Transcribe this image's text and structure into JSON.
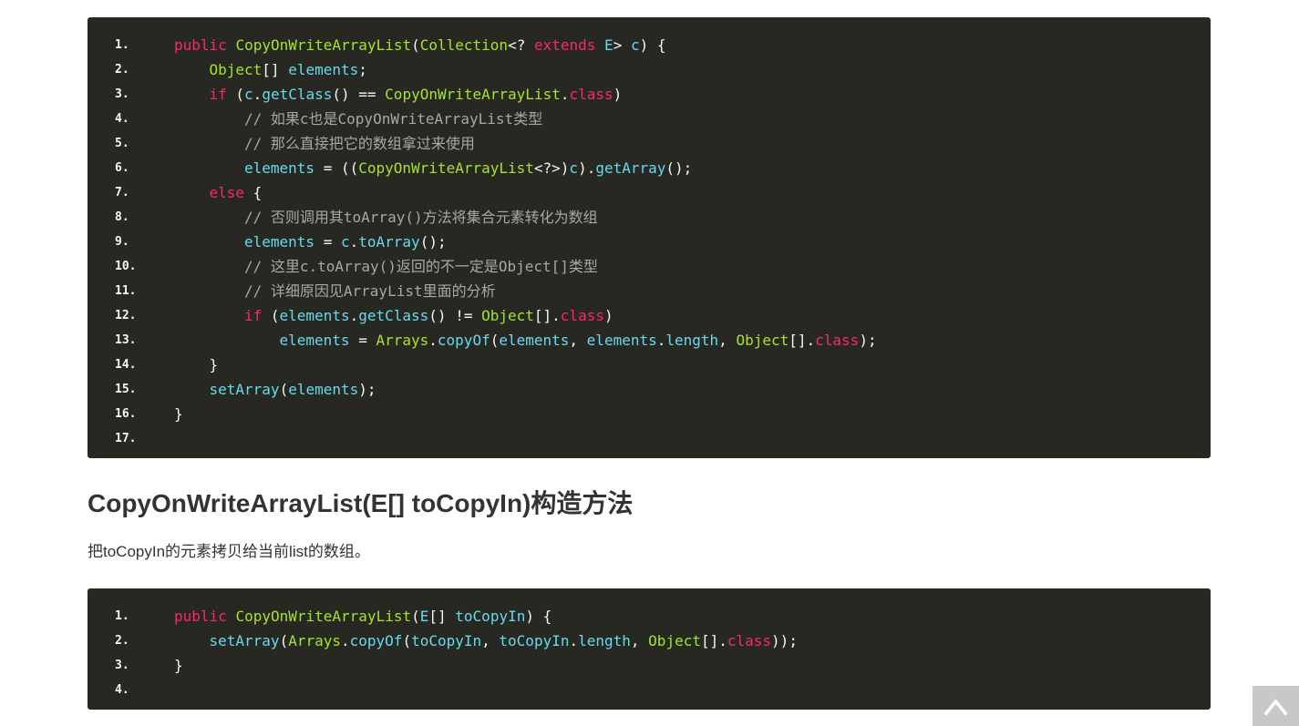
{
  "code_block_1": {
    "lines": [
      {
        "n": "1.",
        "indent": 0,
        "tokens": [
          [
            "k",
            "public"
          ],
          [
            "p",
            " "
          ],
          [
            "t",
            "CopyOnWriteArrayList"
          ],
          [
            "p",
            "("
          ],
          [
            "t",
            "Collection"
          ],
          [
            "p",
            "<? "
          ],
          [
            "k",
            "extends"
          ],
          [
            "p",
            " "
          ],
          [
            "v",
            "E"
          ],
          [
            "p",
            "> "
          ],
          [
            "v",
            "c"
          ],
          [
            "p",
            ") {"
          ]
        ]
      },
      {
        "n": "2.",
        "indent": 1,
        "tokens": [
          [
            "t",
            "Object"
          ],
          [
            "p",
            "[] "
          ],
          [
            "v",
            "elements"
          ],
          [
            "p",
            ";"
          ]
        ]
      },
      {
        "n": "3.",
        "indent": 1,
        "tokens": [
          [
            "k",
            "if"
          ],
          [
            "p",
            " ("
          ],
          [
            "v",
            "c"
          ],
          [
            "p",
            "."
          ],
          [
            "v",
            "getClass"
          ],
          [
            "p",
            "() == "
          ],
          [
            "t",
            "CopyOnWriteArrayList"
          ],
          [
            "p",
            "."
          ],
          [
            "k",
            "class"
          ],
          [
            "p",
            ")"
          ]
        ]
      },
      {
        "n": "4.",
        "indent": 2,
        "tokens": [
          [
            "c",
            "// 如果c也是CopyOnWriteArrayList类型"
          ]
        ]
      },
      {
        "n": "5.",
        "indent": 2,
        "tokens": [
          [
            "c",
            "// 那么直接把它的数组拿过来使用"
          ]
        ]
      },
      {
        "n": "6.",
        "indent": 2,
        "tokens": [
          [
            "v",
            "elements"
          ],
          [
            "p",
            " = (("
          ],
          [
            "t",
            "CopyOnWriteArrayList"
          ],
          [
            "p",
            "<?>)"
          ],
          [
            "v",
            "c"
          ],
          [
            "p",
            ")."
          ],
          [
            "v",
            "getArray"
          ],
          [
            "p",
            "();"
          ]
        ]
      },
      {
        "n": "7.",
        "indent": 1,
        "tokens": [
          [
            "k",
            "else"
          ],
          [
            "p",
            " {"
          ]
        ]
      },
      {
        "n": "8.",
        "indent": 2,
        "tokens": [
          [
            "c",
            "// 否则调用其toArray()方法将集合元素转化为数组"
          ]
        ]
      },
      {
        "n": "9.",
        "indent": 2,
        "tokens": [
          [
            "v",
            "elements"
          ],
          [
            "p",
            " = "
          ],
          [
            "v",
            "c"
          ],
          [
            "p",
            "."
          ],
          [
            "v",
            "toArray"
          ],
          [
            "p",
            "();"
          ]
        ]
      },
      {
        "n": "10.",
        "indent": 2,
        "tokens": [
          [
            "c",
            "// 这里c.toArray()返回的不一定是Object[]类型"
          ]
        ]
      },
      {
        "n": "11.",
        "indent": 2,
        "tokens": [
          [
            "c",
            "// 详细原因见ArrayList里面的分析"
          ]
        ]
      },
      {
        "n": "12.",
        "indent": 2,
        "tokens": [
          [
            "k",
            "if"
          ],
          [
            "p",
            " ("
          ],
          [
            "v",
            "elements"
          ],
          [
            "p",
            "."
          ],
          [
            "v",
            "getClass"
          ],
          [
            "p",
            "() != "
          ],
          [
            "t",
            "Object"
          ],
          [
            "p",
            "[]."
          ],
          [
            "k",
            "class"
          ],
          [
            "p",
            ")"
          ]
        ]
      },
      {
        "n": "13.",
        "indent": 3,
        "tokens": [
          [
            "v",
            "elements"
          ],
          [
            "p",
            " = "
          ],
          [
            "t",
            "Arrays"
          ],
          [
            "p",
            "."
          ],
          [
            "v",
            "copyOf"
          ],
          [
            "p",
            "("
          ],
          [
            "v",
            "elements"
          ],
          [
            "p",
            ", "
          ],
          [
            "v",
            "elements"
          ],
          [
            "p",
            "."
          ],
          [
            "v",
            "length"
          ],
          [
            "p",
            ", "
          ],
          [
            "t",
            "Object"
          ],
          [
            "p",
            "[]."
          ],
          [
            "k",
            "class"
          ],
          [
            "p",
            ");"
          ]
        ]
      },
      {
        "n": "14.",
        "indent": 1,
        "tokens": [
          [
            "p",
            "}"
          ]
        ]
      },
      {
        "n": "15.",
        "indent": 1,
        "tokens": [
          [
            "v",
            "setArray"
          ],
          [
            "p",
            "("
          ],
          [
            "v",
            "elements"
          ],
          [
            "p",
            ");"
          ]
        ]
      },
      {
        "n": "16.",
        "indent": 0,
        "tokens": [
          [
            "p",
            "}"
          ]
        ]
      },
      {
        "n": "17.",
        "indent": 0,
        "tokens": []
      }
    ]
  },
  "section": {
    "title": "CopyOnWriteArrayList(E[] toCopyIn)构造方法",
    "description": "把toCopyIn的元素拷贝给当前list的数组。"
  },
  "code_block_2": {
    "lines": [
      {
        "n": "1.",
        "indent": 0,
        "tokens": [
          [
            "k",
            "public"
          ],
          [
            "p",
            " "
          ],
          [
            "t",
            "CopyOnWriteArrayList"
          ],
          [
            "p",
            "("
          ],
          [
            "v",
            "E"
          ],
          [
            "p",
            "[] "
          ],
          [
            "v",
            "toCopyIn"
          ],
          [
            "p",
            ") {"
          ]
        ]
      },
      {
        "n": "2.",
        "indent": 1,
        "tokens": [
          [
            "v",
            "setArray"
          ],
          [
            "p",
            "("
          ],
          [
            "t",
            "Arrays"
          ],
          [
            "p",
            "."
          ],
          [
            "v",
            "copyOf"
          ],
          [
            "p",
            "("
          ],
          [
            "v",
            "toCopyIn"
          ],
          [
            "p",
            ", "
          ],
          [
            "v",
            "toCopyIn"
          ],
          [
            "p",
            "."
          ],
          [
            "v",
            "length"
          ],
          [
            "p",
            ", "
          ],
          [
            "t",
            "Object"
          ],
          [
            "p",
            "[]."
          ],
          [
            "k",
            "class"
          ],
          [
            "p",
            "));"
          ]
        ]
      },
      {
        "n": "3.",
        "indent": 0,
        "tokens": [
          [
            "p",
            "}"
          ]
        ]
      },
      {
        "n": "4.",
        "indent": 0,
        "tokens": []
      }
    ]
  },
  "back_to_top": {
    "icon": "chevron-up-icon"
  },
  "colors": {
    "code_background": "#272822",
    "keyword": "#f92672",
    "type": "#a6e22e",
    "variable": "#66d9ef",
    "comment": "#a8a8a0",
    "plain": "#f8f8f2",
    "back_to_top_bg": "#c8c8c8"
  }
}
